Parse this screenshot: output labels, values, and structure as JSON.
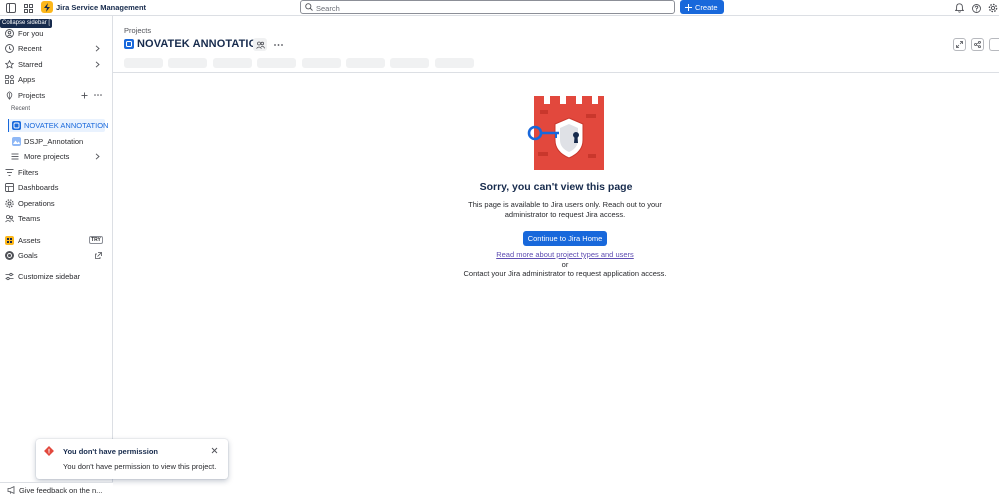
{
  "topbar": {
    "app_name": "Jira Service Management",
    "search_placeholder": "Search",
    "create_label": "Create"
  },
  "tooltip": "Collapse sidebar [",
  "sidebar": {
    "for_you": "For you",
    "recent": "Recent",
    "starred": "Starred",
    "apps": "Apps",
    "projects": "Projects",
    "recent_section": "Recent",
    "project_1": "NOVATEK ANNOTATION",
    "project_2": "DSJP_Annotation",
    "more_projects": "More projects",
    "filters": "Filters",
    "dashboards": "Dashboards",
    "operations": "Operations",
    "teams": "Teams",
    "assets": "Assets",
    "assets_badge": "TRY",
    "goals": "Goals",
    "customize": "Customize sidebar",
    "feedback": "Give feedback on the n..."
  },
  "main": {
    "breadcrumb": "Projects",
    "title": "NOVATEK ANNOTATION",
    "error_title": "Sorry, you can't view this page",
    "error_desc": "This page is available to Jira users only. Reach out to your administrator to request Jira access.",
    "home_button": "Continue to Jira Home",
    "read_more": "Read more about project types and users",
    "or": "or",
    "contact": "Contact your Jira administrator to request application access."
  },
  "flag": {
    "title": "You don't have permission",
    "description": "You don't have permission to view this project."
  },
  "colors": {
    "brand_blue": "#1868db",
    "error_red": "#e2483d",
    "jsm_yellow": "#fcb71b"
  }
}
